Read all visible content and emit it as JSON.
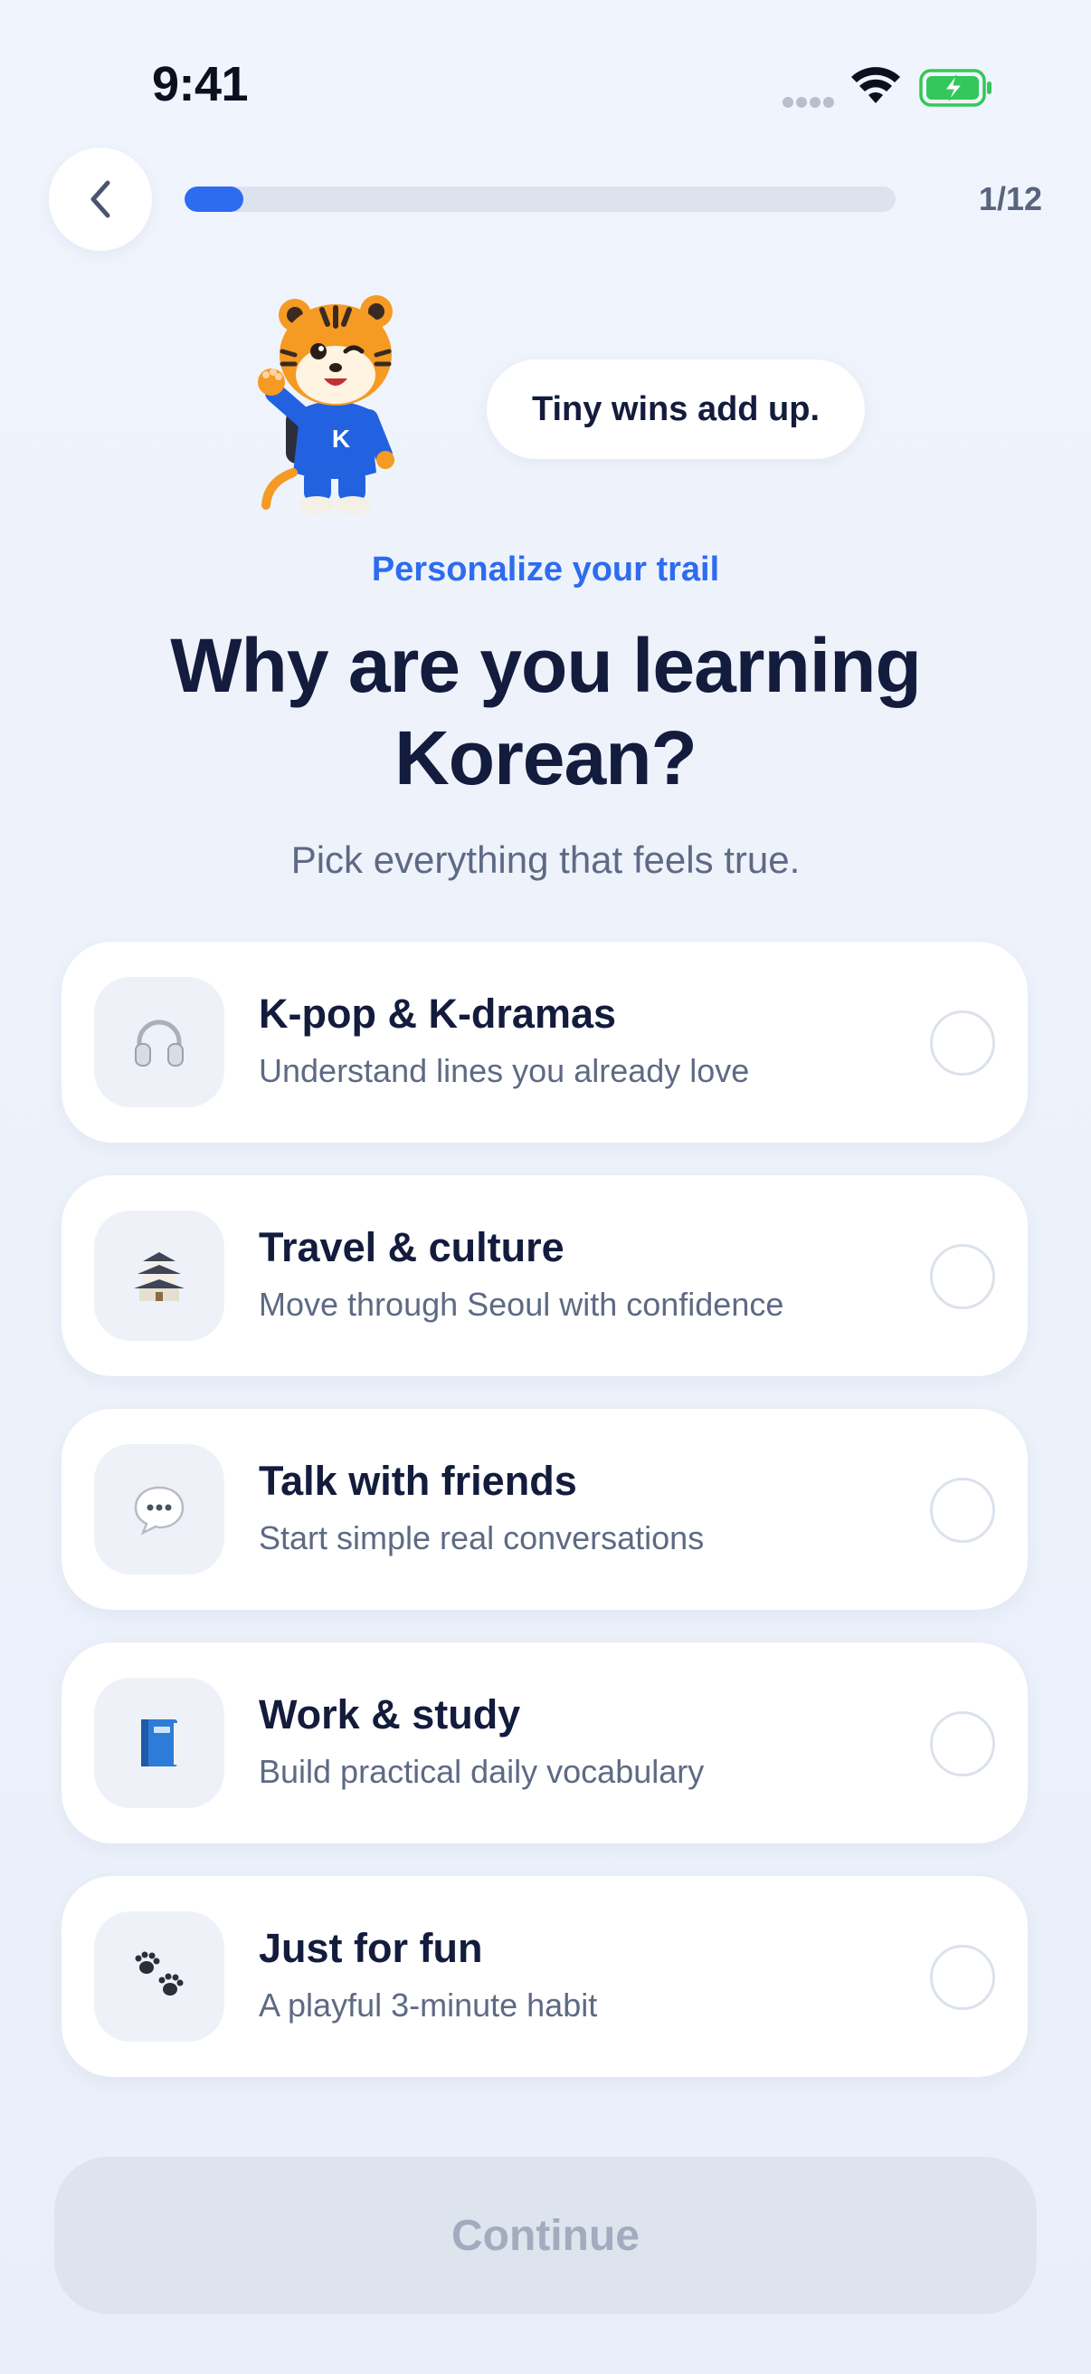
{
  "status_bar": {
    "time": "9:41"
  },
  "header": {
    "progress_text": "1/12",
    "progress_fraction": 0.083
  },
  "mascot": {
    "bubble_text": "Tiny wins add up."
  },
  "heading": {
    "eyebrow": "Personalize your trail",
    "title": "Why are you learning Korean?",
    "subtitle": "Pick everything that feels true."
  },
  "options": [
    {
      "title": "K-pop & K-dramas",
      "description": "Understand lines you already love",
      "icon": "headphones-icon",
      "selected": false
    },
    {
      "title": "Travel & culture",
      "description": "Move through Seoul with confidence",
      "icon": "castle-icon",
      "selected": false
    },
    {
      "title": "Talk with friends",
      "description": "Start simple real conversations",
      "icon": "speech-bubble-icon",
      "selected": false
    },
    {
      "title": "Work & study",
      "description": "Build practical daily vocabulary",
      "icon": "book-icon",
      "selected": false
    },
    {
      "title": "Just for fun",
      "description": "A playful 3-minute habit",
      "icon": "paw-prints-icon",
      "selected": false
    }
  ],
  "continue_label": "Continue",
  "colors": {
    "accent": "#2d6cf0",
    "title": "#131c3d",
    "muted": "#5e6a84",
    "background": "#eef3fb",
    "battery": "#34c759"
  }
}
